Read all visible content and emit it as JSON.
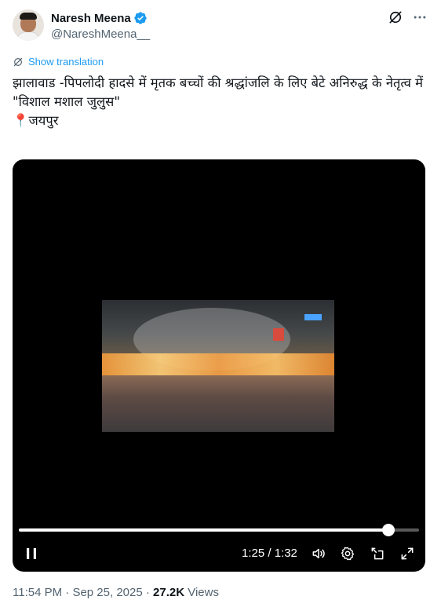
{
  "author": {
    "name": "Naresh Meena",
    "handle": "@NareshMeena__"
  },
  "translate": {
    "label": "Show translation"
  },
  "tweet": {
    "text": "झालावाड -पिपलोदी हादसे में मृतक बच्चों की श्रद्धांजलि के लिए बेटे अनिरुद्ध के नेतृत्व में\n \"विशाल मशाल जुलुस\"\n📍जयपुर"
  },
  "video": {
    "current_time": "1:25",
    "duration": "1:32",
    "timecode": "1:25 / 1:32",
    "progress_fraction": 0.924
  },
  "meta": {
    "time": "11:54 PM",
    "separator": "·",
    "date": "Sep 25, 2025",
    "views_count": "27.2K",
    "views_label": "Views"
  },
  "icons": {
    "verified": "verified-badge-icon",
    "grok": "grok-icon",
    "more": "more-options-icon",
    "translate": "translate-icon",
    "pause": "pause-icon",
    "volume": "volume-icon",
    "settings": "gear-icon",
    "pip": "picture-in-picture-icon",
    "fullscreen": "fullscreen-icon"
  },
  "colors": {
    "accent": "#1d9bf0",
    "text_primary": "#0f1419",
    "text_secondary": "#536471",
    "video_bg": "#000000"
  }
}
